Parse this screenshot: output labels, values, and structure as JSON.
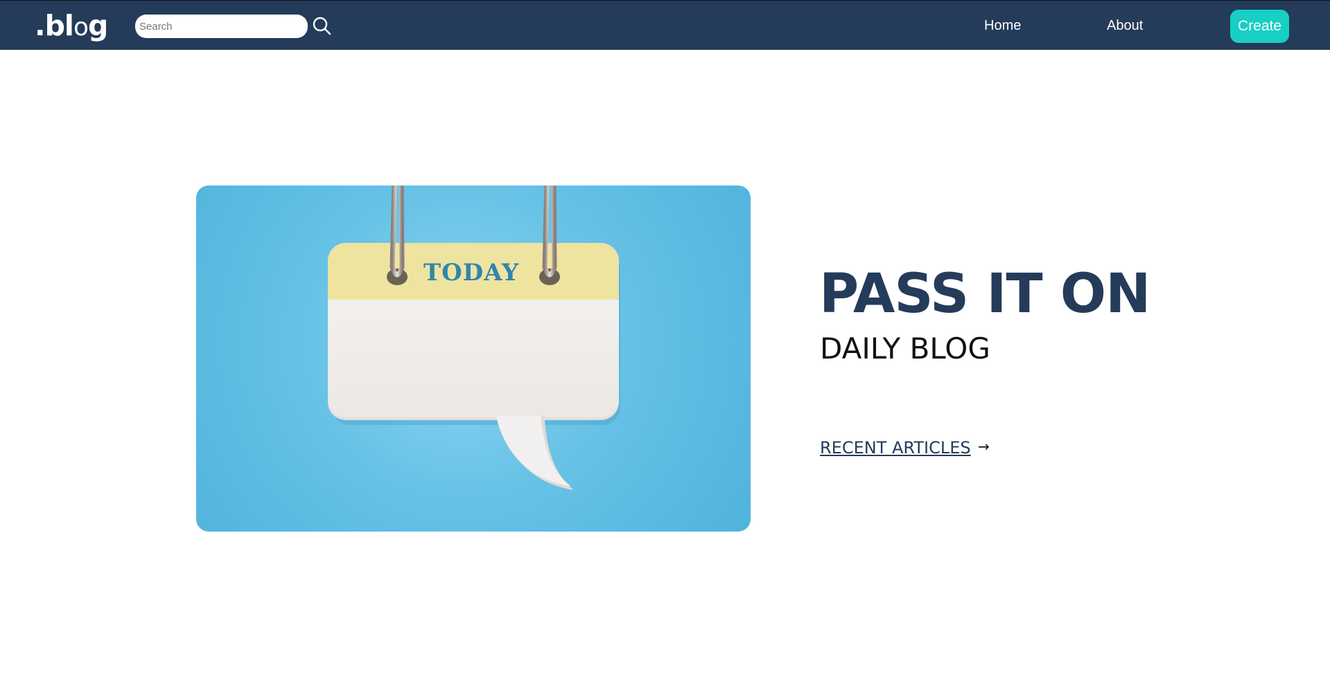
{
  "header": {
    "logo_text": ".bl",
    "logo_o": "o",
    "logo_g": "g",
    "search": {
      "placeholder": "Search",
      "value": ""
    },
    "nav": {
      "home_label": "Home",
      "about_label": "About"
    },
    "create_label": "Create",
    "colors": {
      "navbar_bg": "#243b5a",
      "create_bg": "#18cfc4"
    }
  },
  "hero": {
    "image": {
      "icon": "calendar-speech-bubble",
      "caption_text": "TODAY"
    },
    "title": "PASS IT ON",
    "subtitle": "DAILY BLOG",
    "link_label": "RECENT ARTICLES",
    "link_arrow": "→"
  }
}
